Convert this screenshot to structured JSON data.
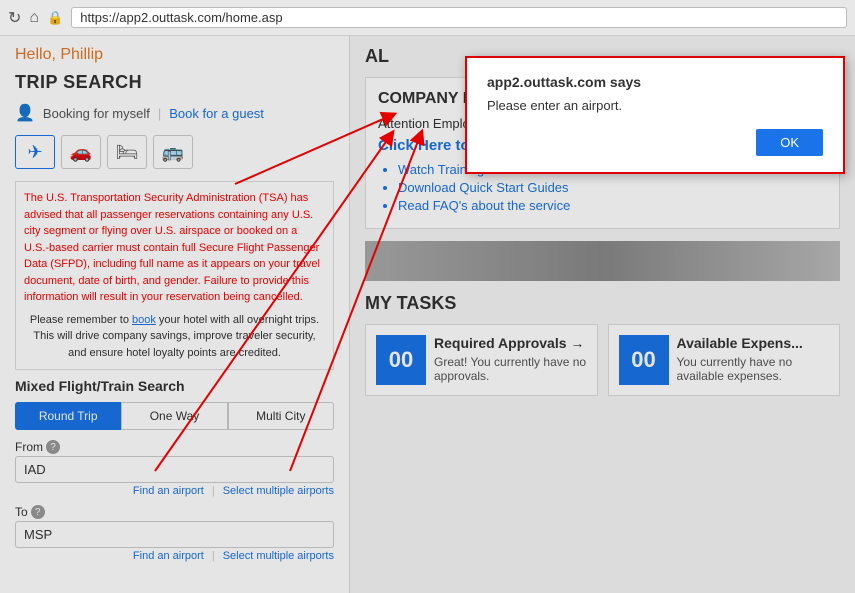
{
  "browser": {
    "url": "https://app2.outtask.com/home.asp"
  },
  "header": {
    "hello": "Hello,",
    "name": "Phillip"
  },
  "tripSearch": {
    "title": "TRIP SEARCH",
    "bookingFor": "Booking for myself",
    "separator": "|",
    "bookForGuest": "Book for a guest"
  },
  "travelIcons": [
    {
      "name": "plane-icon",
      "symbol": "✈",
      "active": true
    },
    {
      "name": "car-icon",
      "symbol": "🚗",
      "active": false
    },
    {
      "name": "hotel-icon",
      "symbol": "🛏",
      "active": false
    },
    {
      "name": "train-icon",
      "symbol": "🚌",
      "active": false
    }
  ],
  "warning": {
    "text": "The U.S. Transportation Security Administration (TSA) has advised that all passenger reservations containing any U.S. city segment or flying over U.S. airspace or booked on a U.S.-based carrier must contain full Secure Flight Passenger Data (SFPD), including full name as it appears on your travel document, date of birth, and gender. Failure to provide this information will result in your reservation being cancelled.",
    "noteText": "Please remember to book your hotel with all overnight trips. This will drive company savings, improve traveler security, and ensure hotel loyalty points are credited.",
    "noteLinkText": "book"
  },
  "mixedFlight": {
    "title": "Mixed Flight/Train Search"
  },
  "tripTypes": [
    {
      "label": "Round Trip",
      "active": true
    },
    {
      "label": "One Way",
      "active": false
    },
    {
      "label": "Multi City",
      "active": false
    }
  ],
  "fromField": {
    "label": "From",
    "value": "IAD",
    "findAirport": "Find an airport",
    "selectMultiple": "Select multiple airports"
  },
  "toField": {
    "label": "To",
    "value": "MSP",
    "findAirport": "Find an airport",
    "selectMultiple": "Select multiple airports"
  },
  "rightPanel": {
    "alTitle": "AL",
    "companyNotes": {
      "title": "COMPANY NOTES",
      "attention": "Attention Employees!",
      "link": "Click Here to access the Employee training portal.",
      "items": [
        "Watch Training Videos",
        "Download Quick Start Guides",
        "Read FAQ's about the service"
      ]
    },
    "myTasks": {
      "title": "MY TASKS",
      "cards": [
        {
          "badge": "00",
          "label": "Required Approvals →",
          "description": "Great! You currently have no approvals."
        },
        {
          "badge": "00",
          "label": "Available Expens...",
          "description": "You currently have no available expenses."
        }
      ]
    }
  },
  "modal": {
    "title": "app2.outtask.com says",
    "message": "Please enter an airport.",
    "okLabel": "OK"
  }
}
